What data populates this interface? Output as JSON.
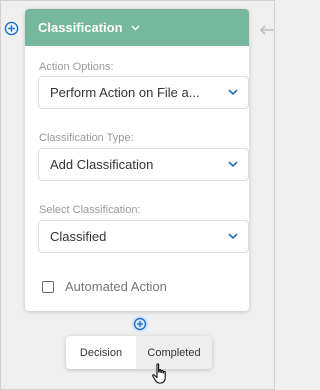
{
  "card": {
    "title": "Classification",
    "header_color": "#76b89d"
  },
  "fields": [
    {
      "label": "Action Options:",
      "value": "Perform Action on File a..."
    },
    {
      "label": "Classification Type:",
      "value": "Add Classification"
    },
    {
      "label": "Select Classification:",
      "value": "Classified"
    }
  ],
  "checkbox": {
    "label": "Automated Action",
    "checked": false
  },
  "popup": {
    "decision_label": "Decision",
    "completed_label": "Completed"
  },
  "colors": {
    "accent_blue": "#1a73c8",
    "chevron_blue": "#2a6fb0"
  }
}
